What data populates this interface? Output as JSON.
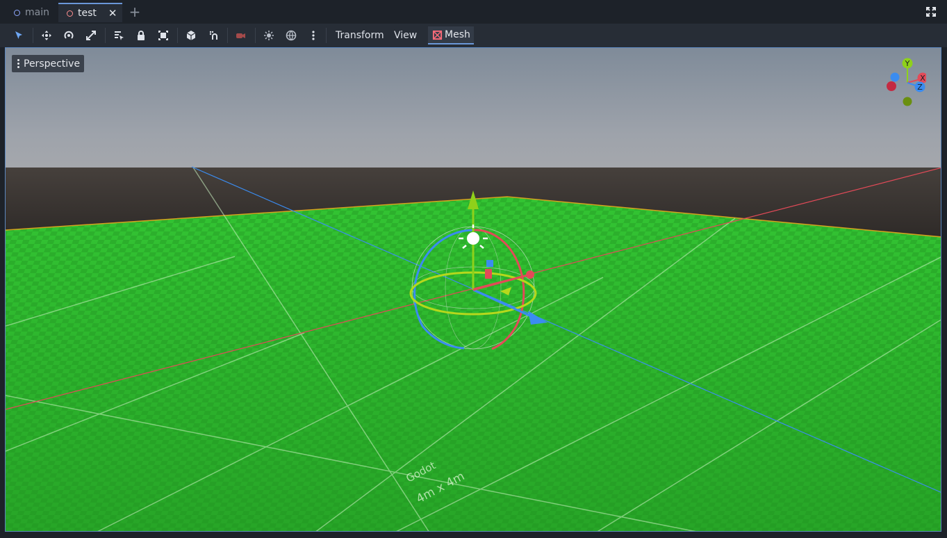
{
  "tabs": [
    {
      "label": "main",
      "active": false
    },
    {
      "label": "test",
      "active": true
    }
  ],
  "tab_close_glyph": "✕",
  "tab_add_glyph": "+",
  "toolbar": {
    "icons": [
      "select-icon",
      "move-icon",
      "rotate-icon",
      "scale-icon",
      "list-select-icon",
      "lock-icon",
      "group-icon",
      "cube-icon",
      "snap-icon",
      "camera-icon",
      "sun-icon",
      "environment-icon",
      "more-icon"
    ],
    "menus": [
      "Transform",
      "View"
    ],
    "mesh_label": "Mesh"
  },
  "viewport": {
    "view_label": "Perspective",
    "gizmo_axes": {
      "y": "Y",
      "x": "X",
      "z": "Z"
    },
    "floor_labels": {
      "brand": "Godot",
      "size": "4m x 4m"
    }
  },
  "colors": {
    "accent": "#6a97d8",
    "floor": "#2bb82b",
    "axis_x": "#e34a58",
    "axis_y": "#8fd11a",
    "axis_z": "#3b8cf0"
  }
}
